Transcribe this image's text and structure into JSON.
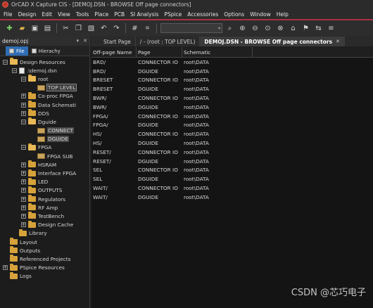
{
  "window": {
    "title": "OrCAD X Capture CIS - [DEMOJ.DSN - BROWSE Off page connectors]"
  },
  "menu": [
    "File",
    "Design",
    "Edit",
    "View",
    "Tools",
    "Place",
    "PCB",
    "SI Analysis",
    "PSpice",
    "Accessories",
    "Options",
    "Window",
    "Help"
  ],
  "toolbar": {
    "icons": [
      "new-icon",
      "open-icon",
      "save-icon",
      "print-icon",
      "cut-icon",
      "copy-icon",
      "paste-icon",
      "undo-icon",
      "redo-icon",
      "grid-icon",
      "snap-icon",
      "find-icon",
      "zoom-in-icon",
      "zoom-out-icon",
      "zoom-area-icon",
      "zoom-all-icon",
      "home-icon",
      "drc-icon",
      "netlist-icon",
      "bom-icon"
    ]
  },
  "project_panel": {
    "title": "demoj.opj",
    "tabs": [
      {
        "label": "File"
      },
      {
        "label": "Hierachy"
      }
    ]
  },
  "tree": [
    {
      "label": "Design Resources",
      "indent": 0,
      "expander": "-",
      "icon": "folder-open"
    },
    {
      "label": ".\\demoj.dsn",
      "indent": 1,
      "expander": "-",
      "icon": "file"
    },
    {
      "label": "root",
      "indent": 2,
      "expander": "-",
      "icon": "folder-open"
    },
    {
      "label": "TOP LEVEL",
      "indent": 3,
      "expander": "",
      "icon": "page",
      "state": "selected"
    },
    {
      "label": "Co-proc FPGA",
      "indent": 2,
      "expander": "+",
      "icon": "folder"
    },
    {
      "label": "Data Schemati",
      "indent": 2,
      "expander": "+",
      "icon": "folder"
    },
    {
      "label": "DDS",
      "indent": 2,
      "expander": "+",
      "icon": "folder"
    },
    {
      "label": "Dguide",
      "indent": 2,
      "expander": "-",
      "icon": "folder-open"
    },
    {
      "label": "CONNECT",
      "indent": 3,
      "expander": "",
      "icon": "page",
      "state": "highlight"
    },
    {
      "label": "DGUIDE",
      "indent": 3,
      "expander": "",
      "icon": "page",
      "state": "highlight"
    },
    {
      "label": "FPGA",
      "indent": 2,
      "expander": "-",
      "icon": "folder-open"
    },
    {
      "label": "FPGA SUB",
      "indent": 3,
      "expander": "",
      "icon": "page"
    },
    {
      "label": "HSRAM",
      "indent": 2,
      "expander": "+",
      "icon": "folder"
    },
    {
      "label": "Interface FPGA",
      "indent": 2,
      "expander": "+",
      "icon": "folder"
    },
    {
      "label": "LED",
      "indent": 2,
      "expander": "+",
      "icon": "folder"
    },
    {
      "label": "OUTPUTS",
      "indent": 2,
      "expander": "+",
      "icon": "folder"
    },
    {
      "label": "Regulators",
      "indent": 2,
      "expander": "+",
      "icon": "folder"
    },
    {
      "label": "RF Amp",
      "indent": 2,
      "expander": "+",
      "icon": "folder"
    },
    {
      "label": "TestBench",
      "indent": 2,
      "expander": "+",
      "icon": "folder"
    },
    {
      "label": "Design Cache",
      "indent": 2,
      "expander": "+",
      "icon": "folder"
    },
    {
      "label": "Library",
      "indent": 1,
      "expander": "",
      "icon": "folder"
    },
    {
      "label": "Layout",
      "indent": 0,
      "expander": "",
      "icon": "folder"
    },
    {
      "label": "Outputs",
      "indent": 0,
      "expander": "",
      "icon": "folder"
    },
    {
      "label": "Referenced Projects",
      "indent": 0,
      "expander": "",
      "icon": "folder"
    },
    {
      "label": "PSpice Resources",
      "indent": 0,
      "expander": "+",
      "icon": "folder"
    },
    {
      "label": "Logs",
      "indent": 0,
      "expander": "",
      "icon": "folder"
    }
  ],
  "doc_tabs": [
    {
      "label": "Start Page",
      "active": false
    },
    {
      "label": "/ - (root : TOP LEVEL)",
      "active": false
    },
    {
      "label": "DEMOJ.DSN - BROWSE Off page connectors",
      "active": true
    }
  ],
  "grid": {
    "columns": [
      "Off-page Name",
      "Page",
      "Schematic"
    ],
    "rows": [
      [
        "BRD/",
        "CONNECTOR IO",
        "root\\DATA"
      ],
      [
        "BRD/",
        "DGUIDE",
        "root\\DATA"
      ],
      [
        "BRESET",
        "CONNECTOR IO",
        "root\\DATA"
      ],
      [
        "BRESET",
        "DGUIDE",
        "root\\DATA"
      ],
      [
        "BWR/",
        "CONNECTOR IO",
        "root\\DATA"
      ],
      [
        "BWR/",
        "DGUIDE",
        "root\\DATA"
      ],
      [
        "FPGA/",
        "CONNECTOR IO",
        "root\\DATA"
      ],
      [
        "FPGA/",
        "DGUIDE",
        "root\\DATA"
      ],
      [
        "HS/",
        "CONNECTOR IO",
        "root\\DATA"
      ],
      [
        "HS/",
        "DGUIDE",
        "root\\DATA"
      ],
      [
        "RESET/",
        "CONNECTOR IO",
        "root\\DATA"
      ],
      [
        "RESET/",
        "DGUIDE",
        "root\\DATA"
      ],
      [
        "SEL",
        "CONNECTOR IO",
        "root\\DATA"
      ],
      [
        "SEL",
        "DGUIDE",
        "root\\DATA"
      ],
      [
        "WAIT/",
        "CONNECTOR IO",
        "root\\DATA"
      ],
      [
        "WAIT/",
        "DGUIDE",
        "root\\DATA"
      ]
    ]
  },
  "watermark": "CSDN @芯巧电子"
}
